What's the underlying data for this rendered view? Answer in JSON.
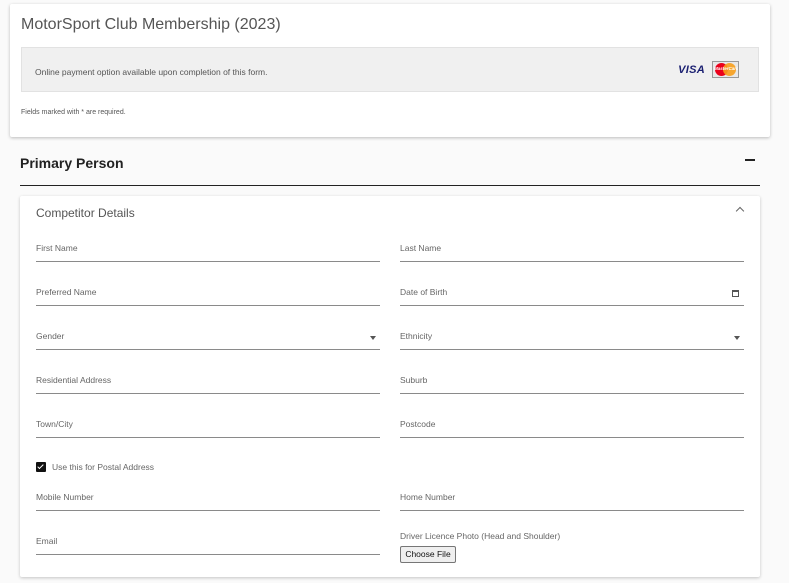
{
  "header": {
    "title": "MotorSport Club Membership (2023)",
    "payment_notice": "Online payment option available upon completion of this form.",
    "visa_label": "VISA",
    "mastercard_label": "MasterCard",
    "required_note": "Fields marked with * are required."
  },
  "section": {
    "title": "Primary Person",
    "collapse_icon": "minus-icon"
  },
  "panel": {
    "title": "Competitor Details",
    "collapse_icon": "chevron-up-icon"
  },
  "fields": {
    "first_name": "First Name",
    "last_name": "Last Name",
    "preferred_name": "Preferred Name",
    "date_of_birth": "Date of Birth",
    "gender": "Gender",
    "ethnicity": "Ethnicity",
    "residential_address": "Residential Address",
    "suburb": "Suburb",
    "town_city": "Town/City",
    "postcode": "Postcode",
    "mobile_number": "Mobile Number",
    "home_number": "Home Number",
    "email": "Email"
  },
  "postal_checkbox": {
    "label": "Use this for Postal Address",
    "checked": true
  },
  "licence": {
    "label": "Driver Licence Photo (Head and Shoulder)",
    "button_label": "Choose File"
  }
}
